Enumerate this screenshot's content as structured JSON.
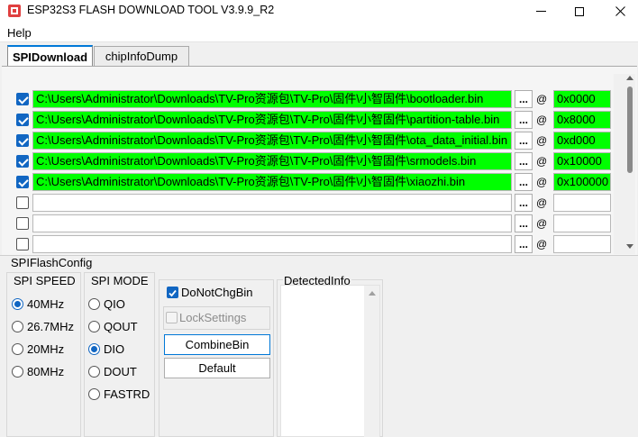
{
  "window": {
    "title": "ESP32S3 FLASH DOWNLOAD TOOL V3.9.9_R2",
    "min_glyph": "—",
    "max_glyph": "☐",
    "close_glyph": "✕"
  },
  "menu": {
    "help": "Help"
  },
  "tabs": [
    {
      "label": "SPIDownload",
      "active": true
    },
    {
      "label": "chipInfoDump",
      "active": false
    }
  ],
  "files": [
    {
      "checked": true,
      "path": "C:\\Users\\Administrator\\Downloads\\TV-Pro资源包\\TV-Pro\\固件\\小智固件\\bootloader.bin",
      "address": "0x0000"
    },
    {
      "checked": true,
      "path": "C:\\Users\\Administrator\\Downloads\\TV-Pro资源包\\TV-Pro\\固件\\小智固件\\partition-table.bin",
      "address": "0x8000"
    },
    {
      "checked": true,
      "path": "C:\\Users\\Administrator\\Downloads\\TV-Pro资源包\\TV-Pro\\固件\\小智固件\\ota_data_initial.bin",
      "address": "0xd000"
    },
    {
      "checked": true,
      "path": "C:\\Users\\Administrator\\Downloads\\TV-Pro资源包\\TV-Pro\\固件\\小智固件\\srmodels.bin",
      "address": "0x10000"
    },
    {
      "checked": true,
      "path": "C:\\Users\\Administrator\\Downloads\\TV-Pro资源包\\TV-Pro\\固件\\小智固件\\xiaozhi.bin",
      "address": "0x100000"
    },
    {
      "checked": false,
      "path": "",
      "address": ""
    },
    {
      "checked": false,
      "path": "",
      "address": ""
    },
    {
      "checked": false,
      "path": "",
      "address": ""
    }
  ],
  "browse_label": "...",
  "at_label": "@",
  "config": {
    "title": "SPIFlashConfig",
    "spi_speed": {
      "title": "SPI SPEED",
      "options": [
        "40MHz",
        "26.7MHz",
        "20MHz",
        "80MHz"
      ],
      "selected": "40MHz"
    },
    "spi_mode": {
      "title": "SPI MODE",
      "options": [
        "QIO",
        "QOUT",
        "DIO",
        "DOUT",
        "FASTRD"
      ],
      "selected": "DIO"
    },
    "do_not_chg_bin": {
      "label": "DoNotChgBin",
      "checked": true
    },
    "lock_settings": {
      "label": "LockSettings",
      "checked": false,
      "enabled": false
    },
    "combine_bin": "CombineBin",
    "default": "Default",
    "detected_info": {
      "title": "DetectedInfo"
    }
  },
  "colors": {
    "filled_field": "#00ff00",
    "accent": "#1166c2"
  }
}
